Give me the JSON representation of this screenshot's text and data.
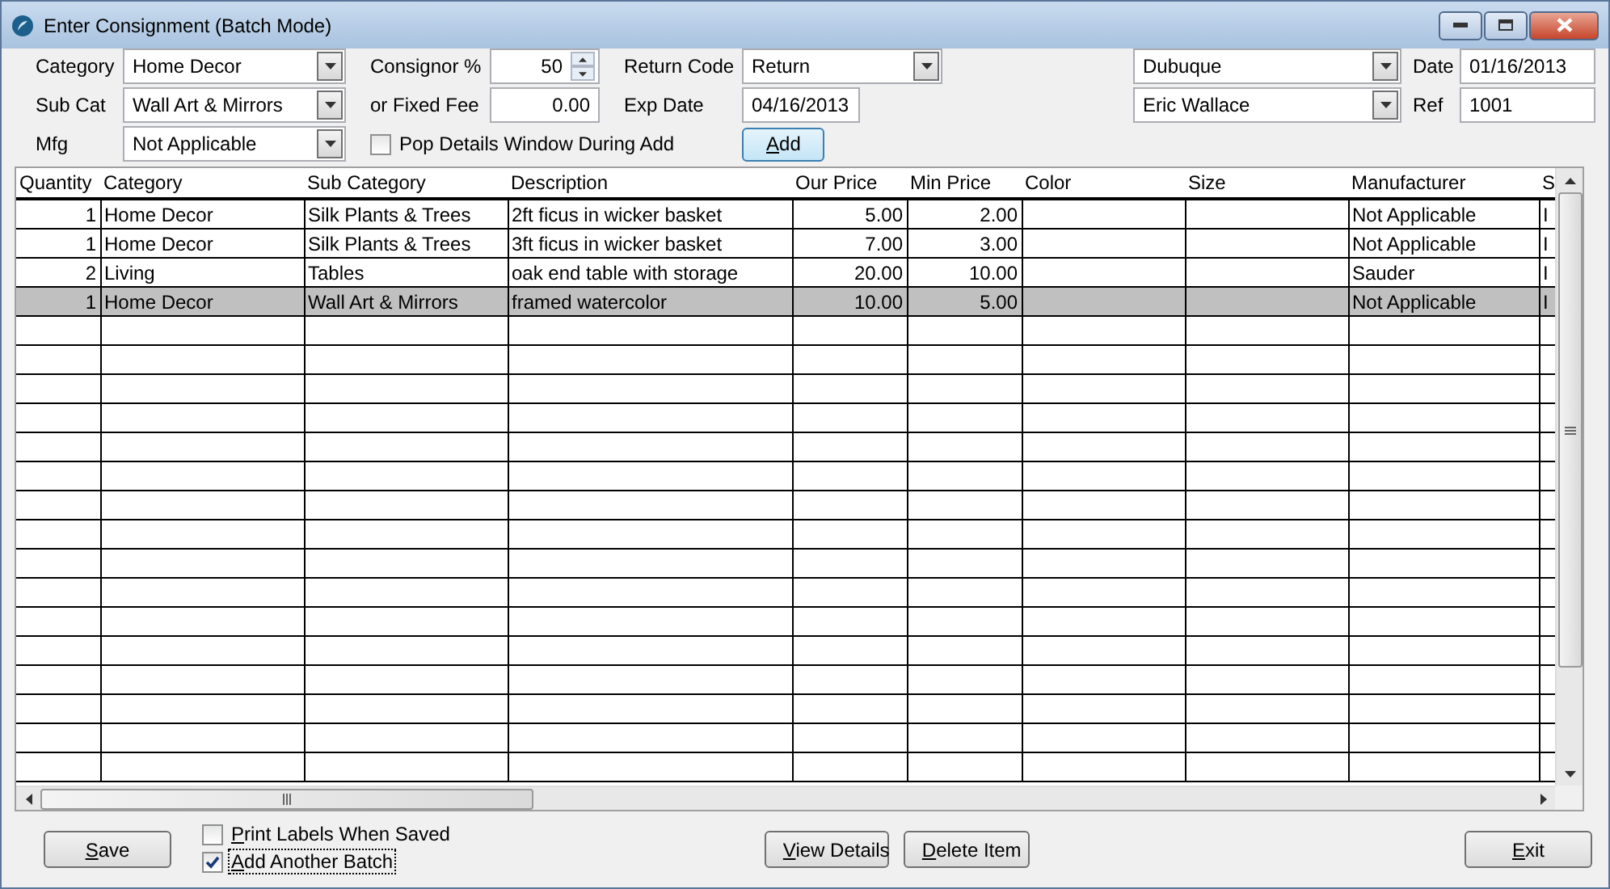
{
  "window": {
    "title": "Enter Consignment (Batch Mode)"
  },
  "form": {
    "category": {
      "label": "Category",
      "value": "Home Decor"
    },
    "sub_cat": {
      "label": "Sub Cat",
      "value": "Wall Art & Mirrors"
    },
    "mfg": {
      "label": "Mfg",
      "value": "Not Applicable"
    },
    "consignor_pct": {
      "label": "Consignor %",
      "value": "50"
    },
    "fixed_fee": {
      "label": "or Fixed Fee",
      "value": "0.00"
    },
    "pop_details": {
      "label": "Pop Details Window During Add",
      "checked": false,
      "focused": false
    },
    "return_code": {
      "label": "Return Code",
      "value": "Return"
    },
    "exp_date": {
      "label": "Exp Date",
      "value": "04/16/2013"
    },
    "add_button": "Add",
    "location": {
      "value": "Dubuque"
    },
    "consignor": {
      "value": "Eric Wallace"
    },
    "date": {
      "label": "Date",
      "value": "01/16/2013"
    },
    "ref": {
      "label": "Ref",
      "value": "1001"
    }
  },
  "table": {
    "columns": [
      {
        "label": "Quantity",
        "kind": "number"
      },
      {
        "label": "Category",
        "kind": "text"
      },
      {
        "label": "Sub Category",
        "kind": "text"
      },
      {
        "label": "Description",
        "kind": "text"
      },
      {
        "label": "Our Price",
        "kind": "number"
      },
      {
        "label": "Min Price",
        "kind": "number"
      },
      {
        "label": "Color",
        "kind": "text"
      },
      {
        "label": "Size",
        "kind": "text"
      },
      {
        "label": "Manufacturer",
        "kind": "text"
      },
      {
        "label": "S",
        "kind": "text"
      }
    ],
    "rows": [
      {
        "cells": [
          "1",
          "Home Decor",
          "Silk Plants & Trees",
          "2ft ficus in wicker basket",
          "5.00",
          "2.00",
          "",
          "",
          "Not Applicable",
          "I"
        ],
        "selected": false
      },
      {
        "cells": [
          "1",
          "Home Decor",
          "Silk Plants & Trees",
          "3ft ficus in wicker basket",
          "7.00",
          "3.00",
          "",
          "",
          "Not Applicable",
          "I"
        ],
        "selected": false
      },
      {
        "cells": [
          "2",
          "Living",
          "Tables",
          "oak end table with storage",
          "20.00",
          "10.00",
          "",
          "",
          "Sauder",
          "I"
        ],
        "selected": false
      },
      {
        "cells": [
          "1",
          "Home Decor",
          "Wall Art & Mirrors",
          "framed watercolor",
          "10.00",
          "5.00",
          "",
          "",
          "Not Applicable",
          "I"
        ],
        "selected": true
      }
    ]
  },
  "footer": {
    "save": "Save",
    "print_labels": {
      "label": "Print Labels When Saved",
      "checked": false,
      "focused": false
    },
    "add_another": {
      "label": "Add Another Batch",
      "checked": true,
      "focused": true
    },
    "view_details": "View Details",
    "delete_item": "Delete Item",
    "exit": "Exit"
  }
}
